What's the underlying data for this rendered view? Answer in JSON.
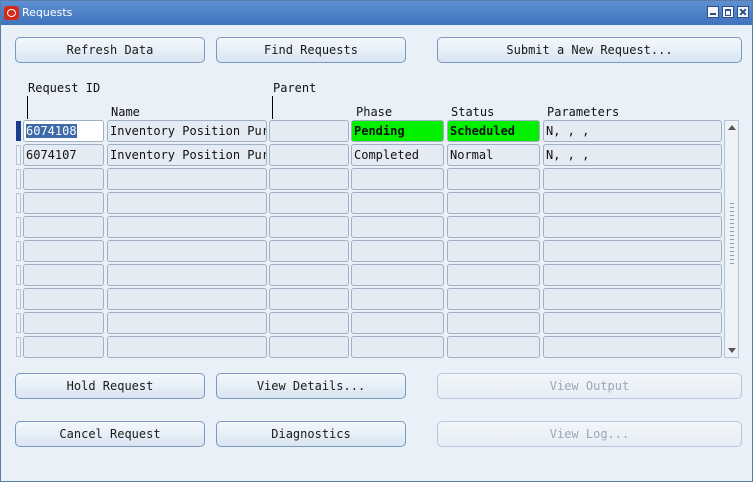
{
  "window": {
    "title": "Requests"
  },
  "buttons": {
    "refresh": "Refresh Data",
    "find": "Find Requests",
    "submit": "Submit a New Request...",
    "hold": "Hold Request",
    "view_details": "View Details...",
    "view_output": "View Output",
    "cancel": "Cancel Request",
    "diagnostics": "Diagnostics",
    "view_log": "View Log..."
  },
  "columns": {
    "request_id": "Request ID",
    "name": "Name",
    "parent": "Parent",
    "phase": "Phase",
    "status": "Status",
    "parameters": "Parameters"
  },
  "rows": [
    {
      "request_id": "6074108",
      "name": "Inventory Position Purge",
      "parent": "",
      "phase": "Pending",
      "status": "Scheduled",
      "parameters": "N, , ,"
    },
    {
      "request_id": "6074107",
      "name": "Inventory Position Purge",
      "parent": "",
      "phase": "Completed",
      "status": "Normal",
      "parameters": "N, , ,"
    }
  ],
  "colors": {
    "title_bar": "#4a7fc6",
    "highlight_phase": "#00f000",
    "selected_id": "#3d6aa8"
  }
}
